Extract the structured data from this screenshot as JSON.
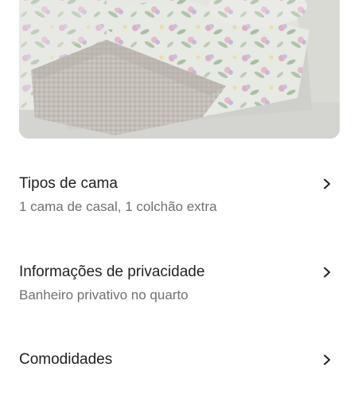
{
  "listing_photo": {
    "icon": "bedroom-photo"
  },
  "rows": [
    {
      "title": "Tipos de cama",
      "subtitle": "1 cama de casal, 1 colchão extra",
      "icon": "chevron-right-icon"
    },
    {
      "title": "Informações de privacidade",
      "subtitle": "Banheiro privativo no quarto",
      "icon": "chevron-right-icon"
    },
    {
      "title": "Comodidades",
      "subtitle": "",
      "icon": "chevron-right-icon"
    }
  ],
  "colors": {
    "text_primary": "#222222",
    "text_secondary": "#717171",
    "background": "#ffffff"
  }
}
